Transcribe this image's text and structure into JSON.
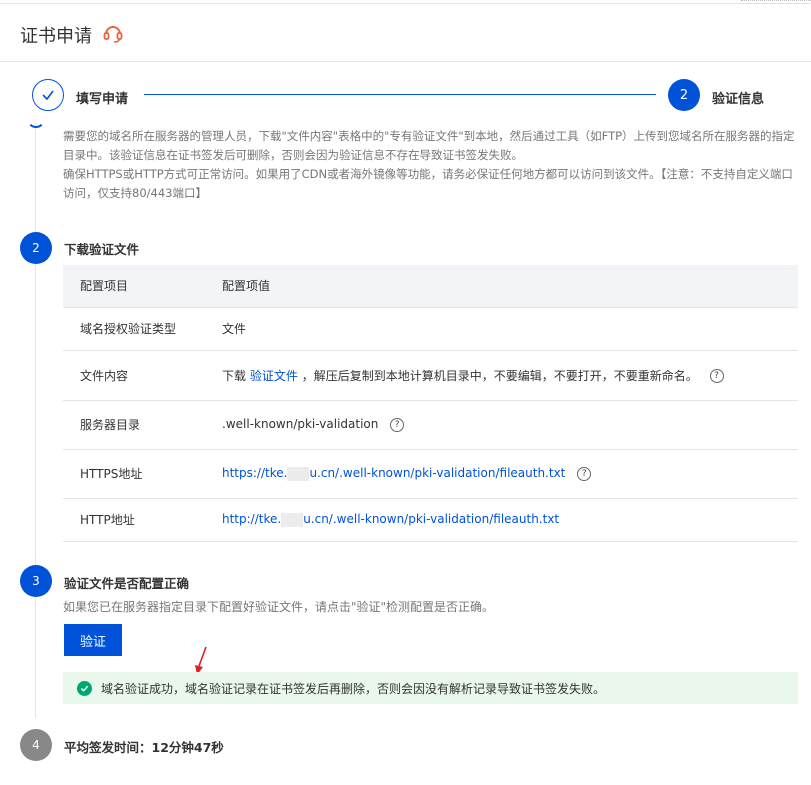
{
  "header": {
    "title": "证书申请",
    "icon": "headset-icon",
    "accent": "#e8663d"
  },
  "steps": [
    {
      "label": "填写申请",
      "state": "done"
    },
    {
      "number": "2",
      "label": "验证信息",
      "state": "active"
    }
  ],
  "intro": {
    "line1": "需要您的域名所在服务器的管理人员，下载\"文件内容\"表格中的\"专有验证文件\"到本地，然后通过工具（如FTP）上传到您域名所在服务器的指定目录中。该验证信息在证书签发后可删除，否则会因为验证信息不存在导致证书签发失败。",
    "line2": "确保HTTPS或HTTP方式可正常访问。如果用了CDN或者海外镜像等功能，请务必保证任何地方都可以访问到该文件。【注意：不支持自定义端口访问，仅支持80/443端口】"
  },
  "section2": {
    "number": "2",
    "title": "下载验证文件",
    "table": {
      "headers": [
        "配置项目",
        "配置项值"
      ],
      "rows": [
        {
          "key": "域名授权验证类型",
          "value": "文件"
        },
        {
          "key": "文件内容",
          "prefix": "下载",
          "link": "验证文件",
          "suffix": "，解压后复制到本地计算机目录中，不要编辑，不要打开，不要重新命名。"
        },
        {
          "key": "服务器目录",
          "value": ".well-known/pki-validation"
        },
        {
          "key": "HTTPS地址",
          "url_start": "https://tke.",
          "url_end": "u.cn/.well-known/pki-validation/fileauth.txt"
        },
        {
          "key": "HTTP地址",
          "url_start": "http://tke.",
          "url_end": "u.cn/.well-known/pki-validation/fileauth.txt"
        }
      ]
    }
  },
  "section3": {
    "number": "3",
    "title": "验证文件是否配置正确",
    "desc": "如果您已在服务器指定目录下配置好验证文件，请点击\"验证\"检测配置是否正确。",
    "button": "验证",
    "success": "域名验证成功，域名验证记录在证书签发后再删除，否则会因没有解析记录导致证书签发失败。"
  },
  "section4": {
    "number": "4",
    "label": "平均签发时间：",
    "value": "12分钟47秒"
  },
  "colors": {
    "primary": "#0052d9",
    "success": "#00a870",
    "success_bg": "#e9f7ec",
    "annotation": "#e02020"
  }
}
